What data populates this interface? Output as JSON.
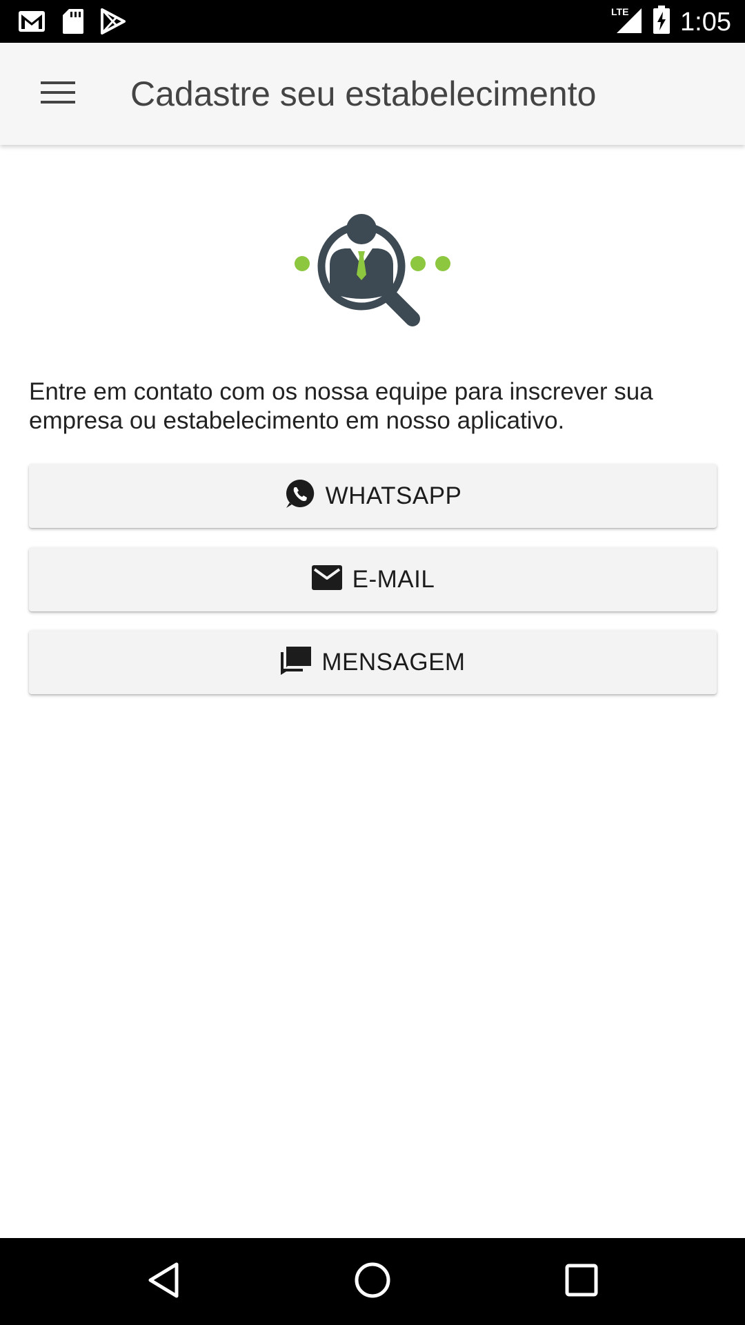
{
  "status_bar": {
    "time": "1:05",
    "network": "LTE",
    "icons": [
      "gmail-icon",
      "sd-card-icon",
      "play-store-icon",
      "signal-icon",
      "battery-charging-icon"
    ]
  },
  "app_bar": {
    "title": "Cadastre seu estabelecimento",
    "menu_icon": "hamburger-menu-icon"
  },
  "content": {
    "intro_text": "Entre em contato com os nossa equipe para inscrever sua empresa ou estabelecimento em nosso aplicativo.",
    "buttons": [
      {
        "label": "WHATSAPP",
        "icon": "whatsapp-icon"
      },
      {
        "label": "E-MAIL",
        "icon": "mail-icon"
      },
      {
        "label": "MENSAGEM",
        "icon": "message-icon"
      }
    ]
  },
  "colors": {
    "accent_green": "#8dc63f",
    "icon_dark": "#3d4a53",
    "app_bar_bg": "#f6f6f6",
    "button_bg": "#f3f3f3"
  }
}
